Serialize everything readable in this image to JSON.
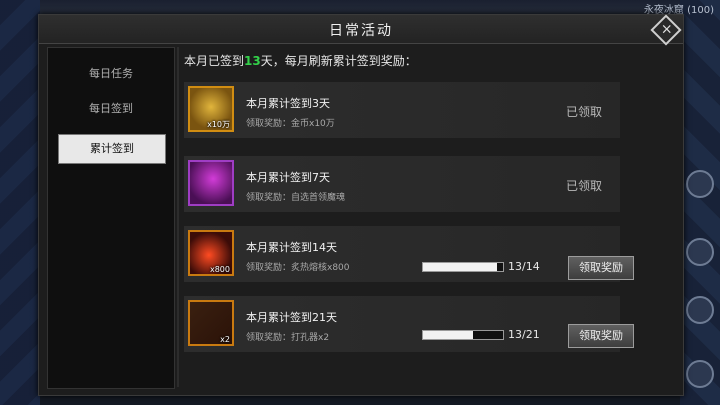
{
  "header": {
    "title": "日常活动",
    "corner_label": "永夜冰窟 (100)"
  },
  "sidebar": {
    "tabs": [
      "每日任务",
      "每日签到",
      "累计签到"
    ],
    "active_index": 2
  },
  "summary": {
    "prefix": "本月已签到",
    "days": "13",
    "suffix": "天，每月刷新累计签到奖励："
  },
  "rewards": [
    {
      "title": "本月累计签到3天",
      "desc": "领取奖励：金币x10万",
      "badge": "x10万",
      "icon": "gold-coins-icon",
      "status": "已领取"
    },
    {
      "title": "本月累计签到7天",
      "desc": "领取奖励：自选首领魔魂",
      "badge": "",
      "icon": "demon-soul-icon",
      "status": "已领取"
    },
    {
      "title": "本月累计签到14天",
      "desc": "领取奖励：炙热熔核x800",
      "badge": "x800",
      "icon": "molten-core-icon",
      "progress_text": "13/14",
      "progress": 0.93,
      "button": "领取奖励"
    },
    {
      "title": "本月累计签到21天",
      "desc": "领取奖励：打孔器x2",
      "badge": "x2",
      "icon": "punch-tool-icon",
      "progress_text": "13/21",
      "progress": 0.62,
      "button": "领取奖励"
    }
  ],
  "colors": {
    "highlight_number": "#33d14a",
    "icon_border": "#c97a10"
  }
}
